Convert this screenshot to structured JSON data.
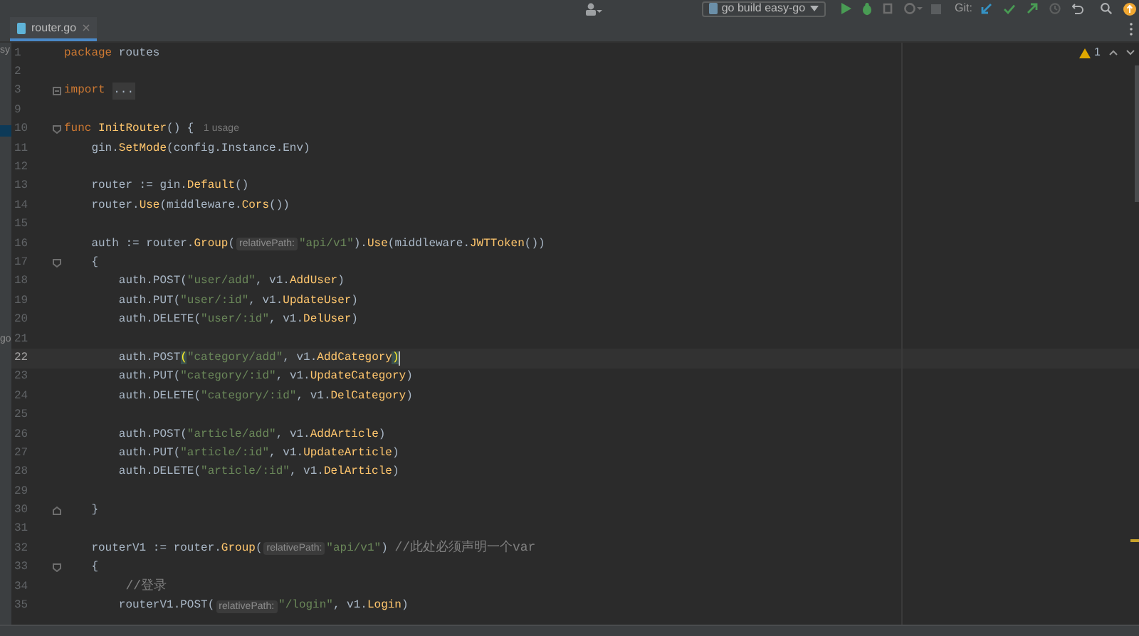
{
  "toolbar": {
    "run_configuration": "go build easy-go",
    "git_label": "Git:"
  },
  "tabs": [
    {
      "label": "router.go",
      "selected": true
    }
  ],
  "project_panel": {
    "fragments": [
      "sy",
      "go"
    ]
  },
  "inspections": {
    "warnings": "1"
  },
  "lines": [
    {
      "number": "1",
      "current": false,
      "tokens": [
        {
          "kind": "kw",
          "t": "package "
        },
        {
          "kind": "plain",
          "t": "routes"
        }
      ]
    },
    {
      "number": "2",
      "current": false
    },
    {
      "number": "3",
      "current": false,
      "fold_marker": {
        "kind": "collapsed"
      },
      "tokens": [
        {
          "kind": "kw",
          "t": "import "
        },
        {
          "kind": "folded",
          "t": "..."
        }
      ]
    },
    {
      "number": "9",
      "current": false
    },
    {
      "number": "10",
      "current": false,
      "fold_marker": {
        "kind": "start"
      },
      "tokens": [
        {
          "kind": "kw",
          "t": "func "
        },
        {
          "kind": "fn",
          "t": "InitRouter"
        },
        {
          "kind": "plain",
          "t": "() { "
        },
        {
          "kind": "usage",
          "t": "1 usage"
        }
      ]
    },
    {
      "number": "11",
      "current": false,
      "tokens": [
        {
          "kind": "plain",
          "t": "    gin."
        },
        {
          "kind": "fn",
          "t": "SetMode"
        },
        {
          "kind": "plain",
          "t": "(config.Instance.Env)"
        }
      ]
    },
    {
      "number": "12",
      "current": false
    },
    {
      "number": "13",
      "current": false,
      "tokens": [
        {
          "kind": "plain",
          "t": "    router := gin."
        },
        {
          "kind": "fn",
          "t": "Default"
        },
        {
          "kind": "plain",
          "t": "()"
        }
      ]
    },
    {
      "number": "14",
      "current": false,
      "tokens": [
        {
          "kind": "plain",
          "t": "    router."
        },
        {
          "kind": "fn",
          "t": "Use"
        },
        {
          "kind": "plain",
          "t": "(middleware."
        },
        {
          "kind": "fn",
          "t": "Cors"
        },
        {
          "kind": "plain",
          "t": "())"
        }
      ]
    },
    {
      "number": "15",
      "current": false
    },
    {
      "number": "16",
      "current": false,
      "tokens": [
        {
          "kind": "plain",
          "t": "    auth := router."
        },
        {
          "kind": "fn",
          "t": "Group"
        },
        {
          "kind": "plain",
          "t": "("
        },
        {
          "kind": "hint",
          "t": "relativePath:"
        },
        {
          "kind": "str",
          "t": "\"api/v1\""
        },
        {
          "kind": "plain",
          "t": ")."
        },
        {
          "kind": "fn",
          "t": "Use"
        },
        {
          "kind": "plain",
          "t": "(middleware."
        },
        {
          "kind": "fn",
          "t": "JWTToken"
        },
        {
          "kind": "plain",
          "t": "())"
        }
      ]
    },
    {
      "number": "17",
      "current": false,
      "fold_marker": {
        "kind": "start"
      },
      "tokens": [
        {
          "kind": "plain",
          "t": "    {"
        }
      ]
    },
    {
      "number": "18",
      "current": false,
      "tokens": [
        {
          "kind": "plain",
          "t": "        auth.POST("
        },
        {
          "kind": "str",
          "t": "\"user/add\""
        },
        {
          "kind": "plain",
          "t": ", v1."
        },
        {
          "kind": "fn",
          "t": "AddUser"
        },
        {
          "kind": "plain",
          "t": ")"
        }
      ]
    },
    {
      "number": "19",
      "current": false,
      "tokens": [
        {
          "kind": "plain",
          "t": "        auth.PUT("
        },
        {
          "kind": "str",
          "t": "\"user/:id\""
        },
        {
          "kind": "plain",
          "t": ", v1."
        },
        {
          "kind": "fn",
          "t": "UpdateUser"
        },
        {
          "kind": "plain",
          "t": ")"
        }
      ]
    },
    {
      "number": "20",
      "current": false,
      "tokens": [
        {
          "kind": "plain",
          "t": "        auth.DELETE("
        },
        {
          "kind": "str",
          "t": "\"user/:id\""
        },
        {
          "kind": "plain",
          "t": ", v1."
        },
        {
          "kind": "fn",
          "t": "DelUser"
        },
        {
          "kind": "plain",
          "t": ")"
        }
      ]
    },
    {
      "number": "21",
      "current": false
    },
    {
      "number": "22",
      "current": true,
      "tokens": [
        {
          "kind": "plain",
          "t": "        auth.POST"
        },
        {
          "kind": "match",
          "t": "("
        },
        {
          "kind": "str",
          "t": "\"category/add\""
        },
        {
          "kind": "plain",
          "t": ", v1."
        },
        {
          "kind": "fn",
          "t": "AddCategory"
        },
        {
          "kind": "match",
          "t": ")"
        }
      ]
    },
    {
      "number": "23",
      "current": false,
      "tokens": [
        {
          "kind": "plain",
          "t": "        auth.PUT("
        },
        {
          "kind": "str",
          "t": "\"category/:id\""
        },
        {
          "kind": "plain",
          "t": ", v1."
        },
        {
          "kind": "fn",
          "t": "UpdateCategory"
        },
        {
          "kind": "plain",
          "t": ")"
        }
      ]
    },
    {
      "number": "24",
      "current": false,
      "tokens": [
        {
          "kind": "plain",
          "t": "        auth.DELETE("
        },
        {
          "kind": "str",
          "t": "\"category/:id\""
        },
        {
          "kind": "plain",
          "t": ", v1."
        },
        {
          "kind": "fn",
          "t": "DelCategory"
        },
        {
          "kind": "plain",
          "t": ")"
        }
      ]
    },
    {
      "number": "25",
      "current": false
    },
    {
      "number": "26",
      "current": false,
      "tokens": [
        {
          "kind": "plain",
          "t": "        auth.POST("
        },
        {
          "kind": "str",
          "t": "\"article/add\""
        },
        {
          "kind": "plain",
          "t": ", v1."
        },
        {
          "kind": "fn",
          "t": "AddArticle"
        },
        {
          "kind": "plain",
          "t": ")"
        }
      ]
    },
    {
      "number": "27",
      "current": false,
      "tokens": [
        {
          "kind": "plain",
          "t": "        auth.PUT("
        },
        {
          "kind": "str",
          "t": "\"article/:id\""
        },
        {
          "kind": "plain",
          "t": ", v1."
        },
        {
          "kind": "fn",
          "t": "UpdateArticle"
        },
        {
          "kind": "plain",
          "t": ")"
        }
      ]
    },
    {
      "number": "28",
      "current": false,
      "tokens": [
        {
          "kind": "plain",
          "t": "        auth.DELETE("
        },
        {
          "kind": "str",
          "t": "\"article/:id\""
        },
        {
          "kind": "plain",
          "t": ", v1."
        },
        {
          "kind": "fn",
          "t": "DelArticle"
        },
        {
          "kind": "plain",
          "t": ")"
        }
      ]
    },
    {
      "number": "29",
      "current": false
    },
    {
      "number": "30",
      "current": false,
      "fold_marker": {
        "kind": "end"
      },
      "tokens": [
        {
          "kind": "plain",
          "t": "    }"
        }
      ]
    },
    {
      "number": "31",
      "current": false
    },
    {
      "number": "32",
      "current": false,
      "tokens": [
        {
          "kind": "plain",
          "t": "    routerV1 := router."
        },
        {
          "kind": "fn",
          "t": "Group"
        },
        {
          "kind": "plain",
          "t": "("
        },
        {
          "kind": "hint",
          "t": "relativePath:"
        },
        {
          "kind": "str",
          "t": "\"api/v1\""
        },
        {
          "kind": "plain",
          "t": ") "
        },
        {
          "kind": "comment",
          "t": "//此处必须声明一个var"
        }
      ]
    },
    {
      "number": "33",
      "current": false,
      "fold_marker": {
        "kind": "start"
      },
      "tokens": [
        {
          "kind": "plain",
          "t": "    {"
        }
      ]
    },
    {
      "number": "34",
      "current": false,
      "tokens": [
        {
          "kind": "comment",
          "t": "        //登录"
        }
      ]
    },
    {
      "number": "35",
      "current": false,
      "tokens": [
        {
          "kind": "plain",
          "t": "        routerV1.POST("
        },
        {
          "kind": "hint",
          "t": "relativePath:"
        },
        {
          "kind": "str",
          "t": "\"/login\""
        },
        {
          "kind": "plain",
          "t": ", v1."
        },
        {
          "kind": "fn",
          "t": "Login"
        },
        {
          "kind": "plain",
          "t": ")"
        }
      ]
    }
  ]
}
